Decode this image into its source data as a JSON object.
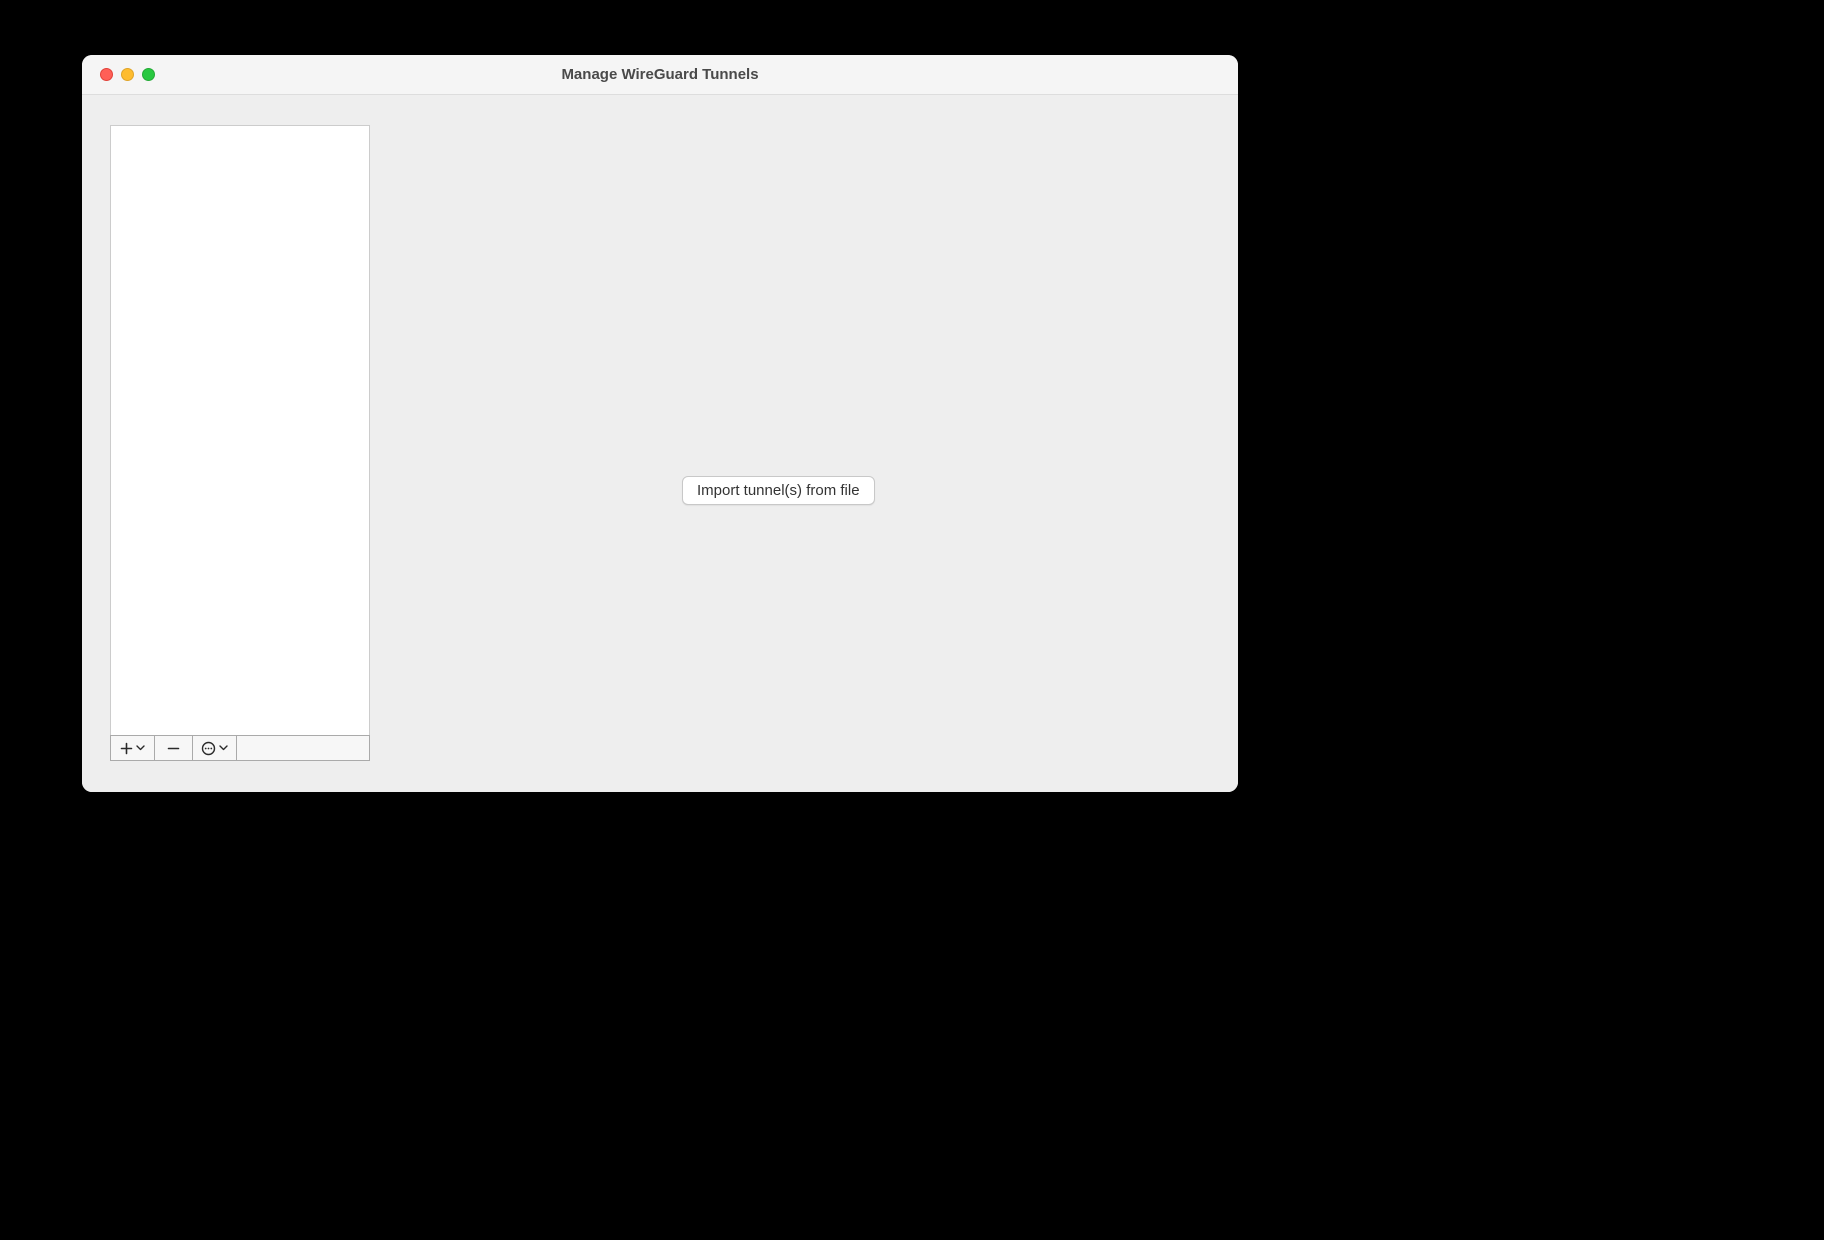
{
  "window": {
    "title": "Manage WireGuard Tunnels"
  },
  "main": {
    "import_button_label": "Import tunnel(s) from file"
  },
  "sidebar": {
    "tunnels": []
  }
}
